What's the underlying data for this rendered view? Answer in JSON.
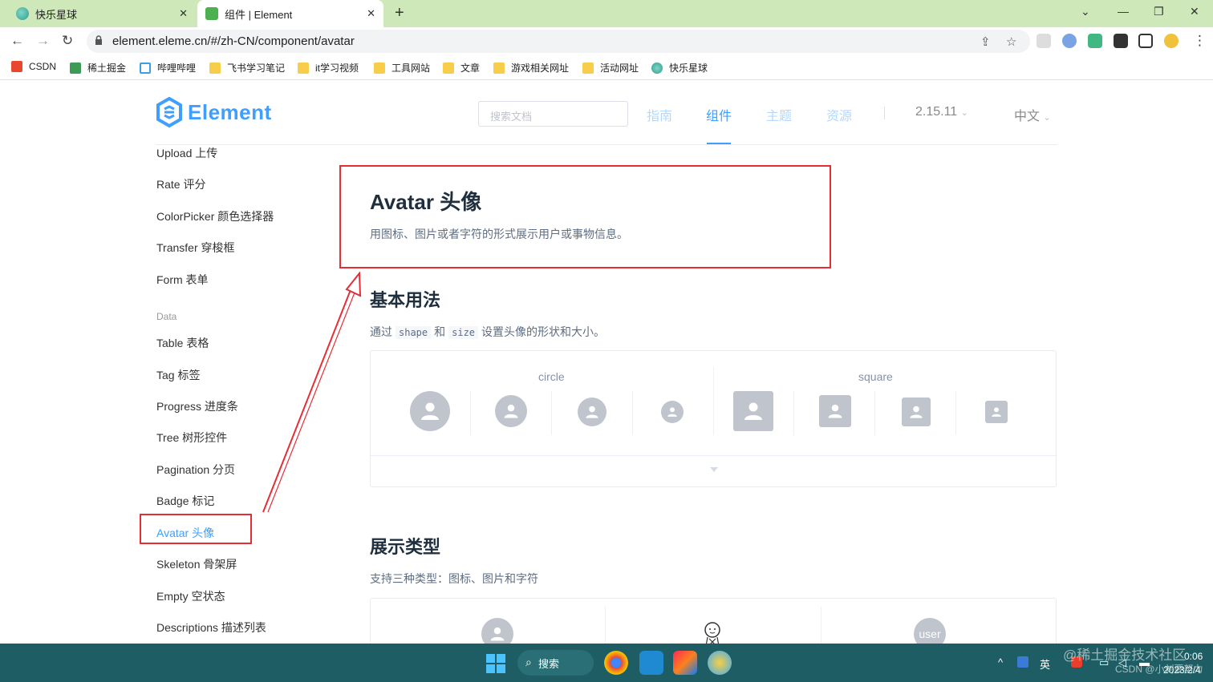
{
  "browser": {
    "tabs": [
      {
        "title": "快乐星球"
      },
      {
        "title": "组件 | Element"
      }
    ],
    "url": "element.eleme.cn/#/zh-CN/component/avatar",
    "bookmarks": [
      "CSDN",
      "稀土掘金",
      "哔哩哔哩",
      "飞书学习笔记",
      "it学习视频",
      "工具网站",
      "文章",
      "游戏相关网址",
      "活动网址",
      "快乐星球"
    ]
  },
  "header": {
    "logo_text": "Element",
    "search_placeholder": "搜索文档",
    "nav": [
      "指南",
      "组件",
      "主题",
      "资源"
    ],
    "version": "2.15.11",
    "language": "中文"
  },
  "sidebar": {
    "items_top": [
      "Upload 上传",
      "Rate 评分",
      "ColorPicker 颜色选择器",
      "Transfer 穿梭框",
      "Form 表单"
    ],
    "group": "Data",
    "items_data": [
      "Table 表格",
      "Tag 标签",
      "Progress 进度条",
      "Tree 树形控件",
      "Pagination 分页",
      "Badge 标记",
      "Avatar 头像",
      "Skeleton 骨架屏",
      "Empty 空状态",
      "Descriptions 描述列表"
    ]
  },
  "content": {
    "title": "Avatar 头像",
    "subtitle": "用图标、图片或者字符的形式展示用户或事物信息。",
    "basic": {
      "heading": "基本用法",
      "desc_pre": "通过",
      "code1": "shape",
      "desc_mid": "和",
      "code2": "size",
      "desc_post": "设置头像的形状和大小。",
      "circle_label": "circle",
      "square_label": "square"
    },
    "types": {
      "heading": "展示类型",
      "desc": "支持三种类型：图标、图片和字符",
      "text_avatar": "user"
    }
  },
  "taskbar": {
    "search": "搜索",
    "ime": "英",
    "time": "0:06",
    "date": "2023/2/4"
  },
  "watermark": {
    "line1": "@稀土掘金技术社区",
    "line2": "CSDN @小刘要努力"
  }
}
